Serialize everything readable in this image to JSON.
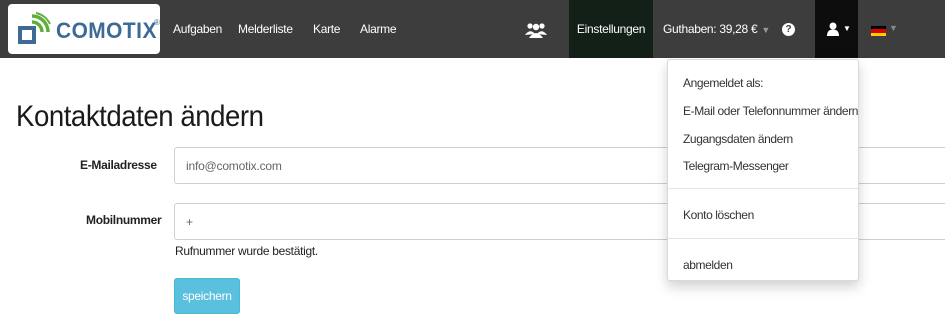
{
  "brand": {
    "name": "COMOTIX",
    "registered": "®"
  },
  "nav": {
    "links": [
      "Aufgaben",
      "Melderliste",
      "Karte",
      "Alarme"
    ],
    "settings_label": "Einstellungen",
    "credit_label": "Guthaben: 39,28 €",
    "help_label": "?",
    "icons": {
      "people": "users-icon",
      "user": "user-icon",
      "help": "question-circle-icon",
      "language": "german-flag-icon"
    }
  },
  "user_menu": {
    "header": "Angemeldet als:",
    "items": [
      "E-Mail oder Telefonnummer ändern",
      "Zugangsdaten ändern",
      "Telegram-Messenger"
    ],
    "delete_account": "Konto löschen",
    "logout": "abmelden"
  },
  "page": {
    "title": "Kontaktdaten ändern",
    "form": {
      "email_label": "E-Mailadresse",
      "email_value": "info@comotix.com",
      "mobile_label": "Mobilnummer",
      "mobile_value": "+",
      "mobile_help": "Rufnummer wurde bestätigt.",
      "save_label": "speichern"
    }
  },
  "colors": {
    "navbar": "#3d3d3d",
    "settings_active": "#122017",
    "user_active": "#0d0d0d",
    "brand_blue": "#3d6b96",
    "brand_green": "#5fae3b",
    "save_button": "#5bc0de"
  }
}
